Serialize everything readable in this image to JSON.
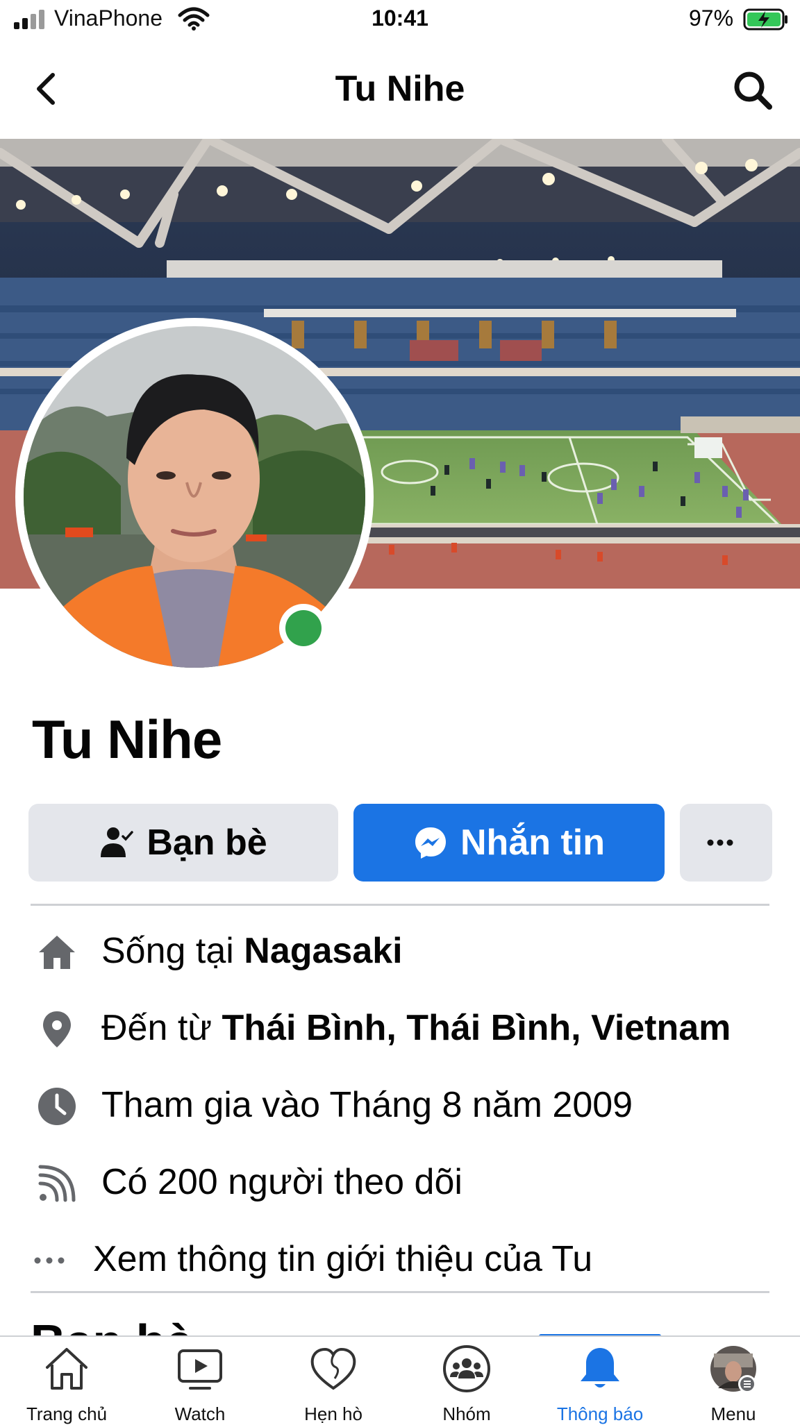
{
  "status_bar": {
    "carrier": "VinaPhone",
    "time": "10:41",
    "battery": "97%"
  },
  "header": {
    "title": "Tu Nihe",
    "back_icon": "chevron-left-icon",
    "search_icon": "search-icon"
  },
  "profile": {
    "name": "Tu Nihe",
    "online": true
  },
  "actions": {
    "friends_label": "Bạn bè",
    "message_label": "Nhắn tin",
    "more_label": "···"
  },
  "intro": [
    {
      "icon": "home-icon",
      "prefix": "Sống tại ",
      "bold": "Nagasaki"
    },
    {
      "icon": "location-pin-icon",
      "prefix": "Đến từ ",
      "bold": "Thái Bình, Thái Bình, Vietnam"
    },
    {
      "icon": "clock-icon",
      "prefix": "Tham gia vào Tháng 8 năm 2009",
      "bold": ""
    },
    {
      "icon": "rss-follow-icon",
      "prefix": "Có 200 người theo dõi",
      "bold": ""
    },
    {
      "icon": "more-dots-icon",
      "prefix": "Xem thông tin giới thiệu của Tu",
      "bold": ""
    }
  ],
  "next_section_partial": "Bạn bè",
  "tab_bar": {
    "items": [
      {
        "label": "Trang chủ",
        "icon": "home-outline-icon",
        "active": false
      },
      {
        "label": "Watch",
        "icon": "video-play-icon",
        "active": false
      },
      {
        "label": "Hẹn hò",
        "icon": "heart-icon",
        "active": false
      },
      {
        "label": "Nhóm",
        "icon": "groups-icon",
        "active": false
      },
      {
        "label": "Thông báo",
        "icon": "bell-icon",
        "active": true
      },
      {
        "label": "Menu",
        "icon": "menu-avatar-icon",
        "active": false
      }
    ]
  },
  "colors": {
    "accent": "#1b74e4",
    "online": "#31a24c",
    "button_gray": "#e4e6eb",
    "icon_gray": "#65676b"
  }
}
